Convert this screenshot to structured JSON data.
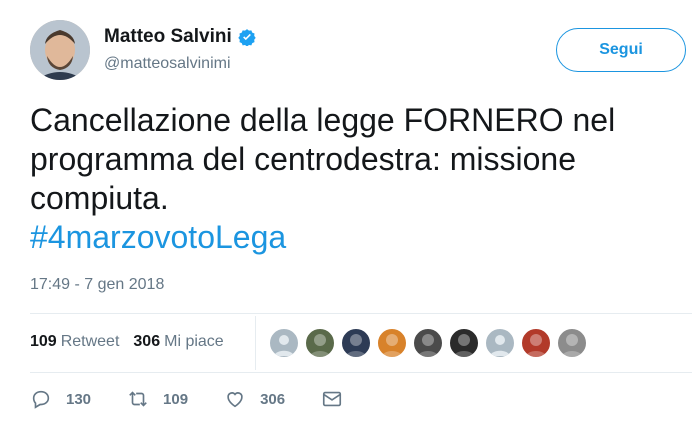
{
  "user": {
    "name": "Matteo Salvini",
    "handle": "@matteosalvinimi",
    "verified_icon": "verified-badge-icon",
    "accent_color": "#1b95e0"
  },
  "follow_button": {
    "label": "Segui"
  },
  "tweet": {
    "text_lines": [
      "Cancellazione della legge FORNERO nel",
      "programma del centrodestra: missione",
      "compiuta."
    ],
    "hashtag": "#4marzovotoLega",
    "timestamp": "17:49 - 7 gen 2018"
  },
  "stats": {
    "retweets": {
      "count": "109",
      "label": "Retweet"
    },
    "likes": {
      "count": "306",
      "label": "Mi piace"
    }
  },
  "liker_avatars": [
    {
      "icon": "default-avatar",
      "color": "#aab8c2"
    },
    {
      "icon": "photo-avatar",
      "color": "#5a6a4a"
    },
    {
      "icon": "photo-avatar",
      "color": "#2d3b55"
    },
    {
      "icon": "photo-avatar",
      "color": "#d8822a"
    },
    {
      "icon": "photo-avatar",
      "color": "#4b4b4b"
    },
    {
      "icon": "photo-avatar",
      "color": "#2b2b2b"
    },
    {
      "icon": "default-avatar",
      "color": "#aab8c2"
    },
    {
      "icon": "photo-avatar",
      "color": "#b23a2a"
    },
    {
      "icon": "photo-avatar",
      "color": "#8c8c8c"
    }
  ],
  "actions": {
    "reply": {
      "icon": "reply-icon",
      "count": "130"
    },
    "retweet": {
      "icon": "retweet-icon",
      "count": "109"
    },
    "like": {
      "icon": "heart-icon",
      "count": "306"
    },
    "message": {
      "icon": "envelope-icon"
    }
  }
}
